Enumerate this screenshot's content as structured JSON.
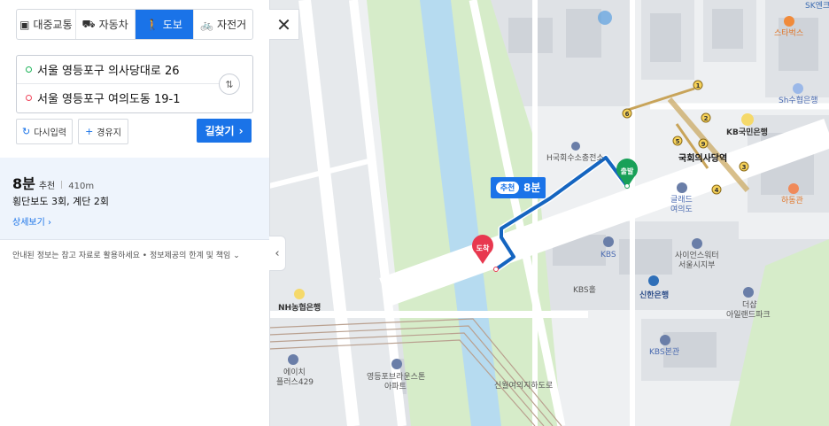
{
  "tabs": [
    {
      "label": "대중교통",
      "icon": "bus-icon",
      "active": false
    },
    {
      "label": "자동차",
      "icon": "car-icon",
      "active": false
    },
    {
      "label": "도보",
      "icon": "walk-icon",
      "active": true
    },
    {
      "label": "자전거",
      "icon": "bicycle-icon",
      "active": false
    }
  ],
  "route": {
    "origin": "서울 영등포구 의사당대로 26",
    "destination": "서울 영등포구 여의도동 19-1"
  },
  "actions": {
    "reset_label": "다시입력",
    "via_label": "경유지",
    "search_label": "길찾기"
  },
  "result": {
    "time": "8분",
    "tag": "추천",
    "distance": "410m",
    "summary": "횡단보도 3회, 계단 2회",
    "detail_label": "상세보기"
  },
  "disclaimer": "안내된 정보는 참고 자료로 활용하세요 • 정보제공의 한계 및 책임",
  "map": {
    "route_badge": {
      "tag": "추천",
      "time": "8분"
    },
    "start_label": "출발",
    "end_label": "도착",
    "places": [
      {
        "name": "SK엔크",
        "kind": "poi"
      },
      {
        "name": "스타벅스",
        "kind": "cafe"
      },
      {
        "name": "Sh수협은행",
        "kind": "bank"
      },
      {
        "name": "KB국민은행",
        "kind": "bank"
      },
      {
        "name": "H국회수소충전소",
        "kind": "poi"
      },
      {
        "name": "국회의사당역",
        "kind": "station"
      },
      {
        "name": "글래드",
        "kind": "hotel"
      },
      {
        "name": "여의도",
        "kind": "hotel"
      },
      {
        "name": "하동관",
        "kind": "food"
      },
      {
        "name": "KBS",
        "kind": "poi"
      },
      {
        "name": "사이언스워터",
        "kind": "poi"
      },
      {
        "name": "서울시지부",
        "kind": "poi"
      },
      {
        "name": "KBS홀",
        "kind": "poi"
      },
      {
        "name": "신한은행",
        "kind": "bank"
      },
      {
        "name": "더샵",
        "kind": "building"
      },
      {
        "name": "아일랜드파크",
        "kind": "building"
      },
      {
        "name": "KBS본관",
        "kind": "poi"
      },
      {
        "name": "NH농협은행",
        "kind": "bank"
      },
      {
        "name": "에이치",
        "kind": "building"
      },
      {
        "name": "플러스429",
        "kind": "building"
      },
      {
        "name": "영등포브라운스톤",
        "kind": "building"
      },
      {
        "name": "아파트",
        "kind": "building"
      },
      {
        "name": "신월여의지하도로",
        "kind": "road"
      }
    ],
    "exits": [
      "1",
      "2",
      "3",
      "4",
      "5",
      "6",
      "9"
    ]
  },
  "colors": {
    "accent": "#1a73e8",
    "route": "#1565c0",
    "start": "#18a058",
    "end": "#e8384f",
    "park": "#d6ecc9",
    "water": "#b6dbf0",
    "subway_line": "#c8a45a"
  }
}
